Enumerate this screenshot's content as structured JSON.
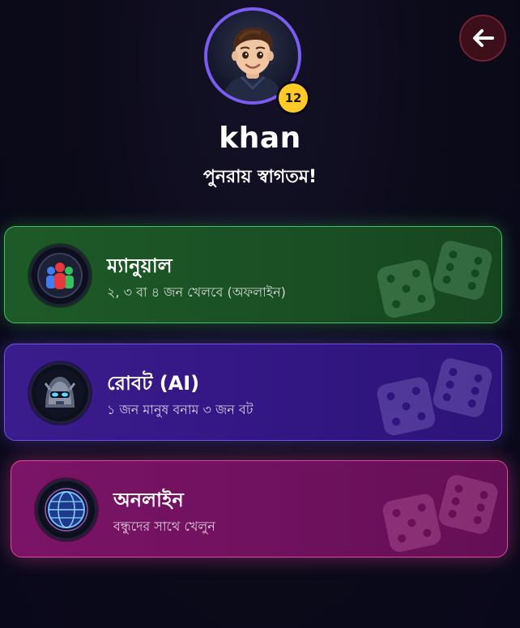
{
  "header": {
    "level": "12",
    "username": "khan",
    "welcome": "পুনরায় স্বাগতম!"
  },
  "modes": [
    {
      "title": "ম্যানুয়াল",
      "subtitle": "২, ৩ বা ৪ জন খেলবে (অফলাইন)",
      "icon": "players-icon",
      "accent": "#3ec35e"
    },
    {
      "title": "রোবট (AI)",
      "subtitle": "১ জন মানুষ বনাম ৩ জন বট",
      "icon": "robot-icon",
      "accent": "#6e54e6"
    },
    {
      "title": "অনলাইন",
      "subtitle": "বন্ধুদের সাথে খেলুন",
      "icon": "globe-icon",
      "accent": "#e0479e"
    }
  ],
  "icons": {
    "back": "arrow-left-icon",
    "avatar": "avatar-icon",
    "decoration": "dice-icon"
  }
}
